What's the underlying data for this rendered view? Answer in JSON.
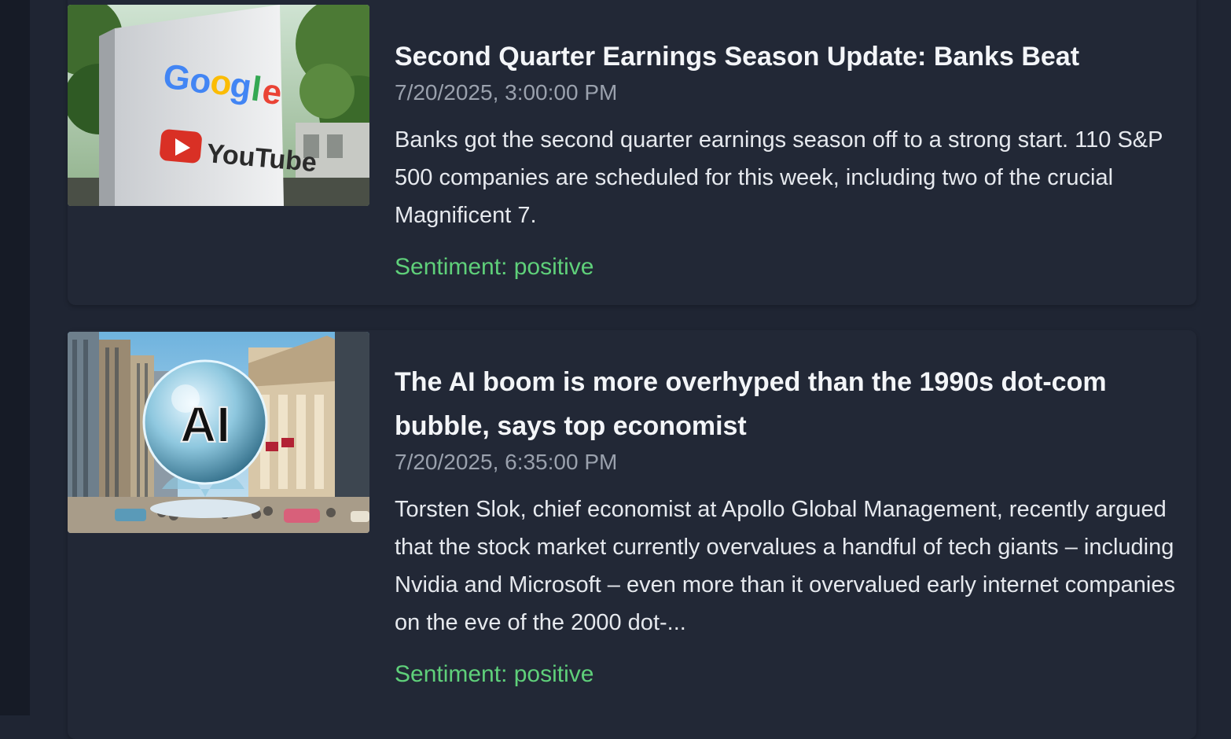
{
  "articles": [
    {
      "title": "Second Quarter Earnings Season Update: Banks Beat",
      "timestamp": "7/20/2025, 3:00:00 PM",
      "summary": "Banks got the second quarter earnings season off to a strong start. 110 S&P 500 companies are scheduled for this week, including two of the crucial Magnificent 7.",
      "sentiment": "Sentiment: positive",
      "image": {
        "sign_text_1": "Google",
        "sign_text_2": "YouTube"
      }
    },
    {
      "title": "The AI boom is more overhyped than the 1990s dot-com bubble, says top economist",
      "timestamp": "7/20/2025, 6:35:00 PM",
      "summary": "Torsten Slok, chief economist at Apollo Global Management, recently argued that the stock market currently overvalues a handful of tech giants – including Nvidia and Microsoft – even more than it overvalued early internet companies on the eve of the 2000 dot-...",
      "sentiment": "Sentiment: positive",
      "image": {
        "bubble_text": "AI"
      }
    }
  ],
  "colors": {
    "background": "#1f2533",
    "card": "#222836",
    "title": "#f3f5f8",
    "timestamp": "#9aa1ad",
    "body": "#e6e9ee",
    "sentiment_positive": "#5fd07a"
  }
}
